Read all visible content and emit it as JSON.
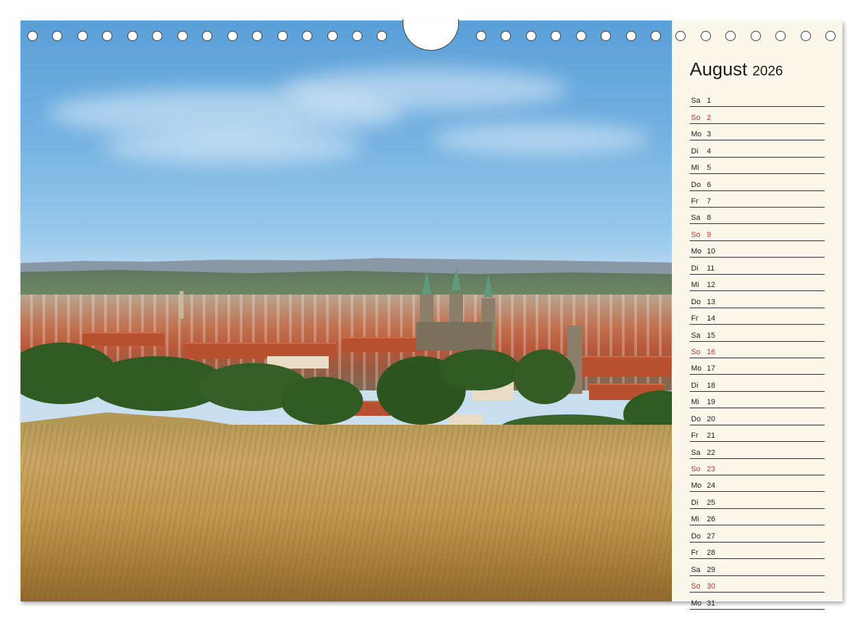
{
  "calendar": {
    "month": "August",
    "year": "2026",
    "days": [
      {
        "wd": "Sa",
        "d": "1"
      },
      {
        "wd": "So",
        "d": "2",
        "sun": true
      },
      {
        "wd": "Mo",
        "d": "3"
      },
      {
        "wd": "Di",
        "d": "4"
      },
      {
        "wd": "Mi",
        "d": "5"
      },
      {
        "wd": "Do",
        "d": "6"
      },
      {
        "wd": "Fr",
        "d": "7"
      },
      {
        "wd": "Sa",
        "d": "8"
      },
      {
        "wd": "So",
        "d": "9",
        "sun": true
      },
      {
        "wd": "Mo",
        "d": "10"
      },
      {
        "wd": "Di",
        "d": "11"
      },
      {
        "wd": "Mi",
        "d": "12"
      },
      {
        "wd": "Do",
        "d": "13"
      },
      {
        "wd": "Fr",
        "d": "14"
      },
      {
        "wd": "Sa",
        "d": "15"
      },
      {
        "wd": "So",
        "d": "16",
        "sun": true
      },
      {
        "wd": "Mo",
        "d": "17"
      },
      {
        "wd": "Di",
        "d": "18"
      },
      {
        "wd": "Mi",
        "d": "19"
      },
      {
        "wd": "Do",
        "d": "20"
      },
      {
        "wd": "Fr",
        "d": "21"
      },
      {
        "wd": "Sa",
        "d": "22"
      },
      {
        "wd": "So",
        "d": "23",
        "sun": true
      },
      {
        "wd": "Mo",
        "d": "24"
      },
      {
        "wd": "Di",
        "d": "25"
      },
      {
        "wd": "Mi",
        "d": "26"
      },
      {
        "wd": "Do",
        "d": "27"
      },
      {
        "wd": "Fr",
        "d": "28"
      },
      {
        "wd": "Sa",
        "d": "29"
      },
      {
        "wd": "So",
        "d": "30",
        "sun": true
      },
      {
        "wd": "Mo",
        "d": "31"
      }
    ]
  },
  "colors": {
    "sunday": "#c8323c",
    "panel_background": "#fbf7ea",
    "ruling": "#2a2a2a"
  }
}
